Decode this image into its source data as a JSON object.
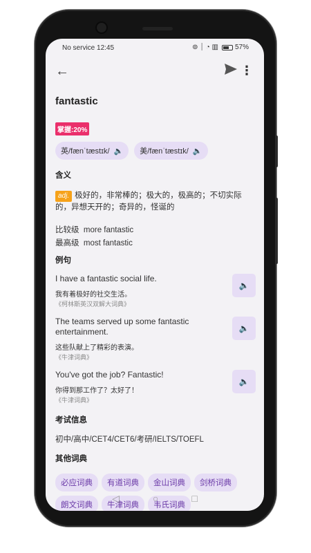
{
  "status": {
    "left": "No service 12:45",
    "icons": "⊚ ⏐ ◔ ▥",
    "battery": "57%"
  },
  "word": "fantastic",
  "mastery": "掌握:20%",
  "pronunciations": [
    {
      "label": "英/fænˈtæstɪk/"
    },
    {
      "label": "美/fænˈtæstɪk/"
    }
  ],
  "sections": {
    "meaning": "含义",
    "examples": "例句",
    "exam": "考试信息",
    "dicts": "其他词典"
  },
  "definition": {
    "pos": "adj.",
    "text": "极好的，非常棒的；极大的，极高的；不切实际的，异想天开的；奇异的，怪诞的"
  },
  "forms": [
    {
      "label": "比较级",
      "value": "more fantastic"
    },
    {
      "label": "最高级",
      "value": "most fantastic"
    }
  ],
  "examples": [
    {
      "en": "I have a fantastic social life.",
      "zh": "我有着极好的社交生活。",
      "src": "《柯林斯英汉双解大词典》"
    },
    {
      "en": "The teams served up some fantastic entertainment.",
      "zh": "这些队献上了精彩的表演。",
      "src": "《牛津词典》"
    },
    {
      "en": "You've got the job? Fantastic!",
      "zh": "你得到那工作了？太好了！",
      "src": "《牛津词典》"
    }
  ],
  "exam_info": "初中/高中/CET4/CET6/考研/IELTS/TOEFL",
  "dictionaries": [
    "必应词典",
    "有道词典",
    "金山词典",
    "剑桥词典",
    "朗文词典",
    "牛津词典",
    "韦氏词典"
  ],
  "nav": {
    "back": "◁",
    "home": "○",
    "recent": "□"
  },
  "colors": {
    "accent": "#7a3bd6",
    "chip_bg": "#e6ddf5",
    "mastery": "#ea2f6b",
    "pos": "#f6a21a"
  }
}
